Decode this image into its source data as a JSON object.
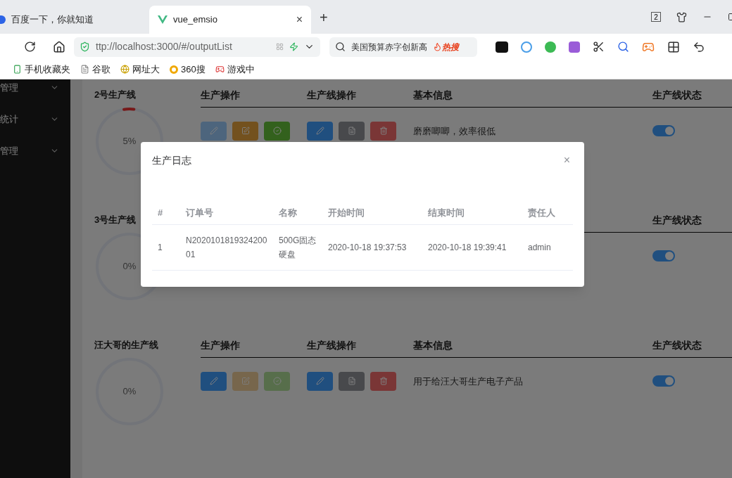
{
  "browser": {
    "tabs": [
      {
        "title": "百度一下，你就知道",
        "selected": false
      },
      {
        "title": "vue_emsio",
        "selected": true,
        "close": "×"
      }
    ],
    "new_tab": "+",
    "window_badge": "2",
    "address": "ttp://localhost:3000/#/outputList",
    "search": {
      "value": "美国预算赤字创新高",
      "hot": "热搜"
    },
    "bookmarks": [
      {
        "label": "手机收藏夹",
        "kind": "phone"
      },
      {
        "label": "谷歌",
        "kind": "page"
      },
      {
        "label": "网址大",
        "kind": "site"
      },
      {
        "label": "360搜",
        "kind": "search"
      },
      {
        "label": "游戏中",
        "kind": "game"
      }
    ]
  },
  "sidebar": {
    "items": [
      {
        "label": "管理"
      },
      {
        "label": "统计"
      },
      {
        "label": "管理"
      }
    ]
  },
  "lines": [
    {
      "name": "2号生产线",
      "percent": "5%",
      "level": 0.05,
      "headers": {
        "ops": "生产操作",
        "line_ops": "生产线操作",
        "info": "基本信息",
        "status": "生产线状态"
      },
      "ops": [
        {
          "kind": "edit",
          "disabled": true
        },
        {
          "kind": "modify",
          "disabled": false
        },
        {
          "kind": "check",
          "disabled": false
        }
      ],
      "line_ops": [
        {
          "kind": "edit"
        },
        {
          "kind": "detail"
        },
        {
          "kind": "delete"
        }
      ],
      "info": "磨磨唧唧，效率很低",
      "on": true
    },
    {
      "name": "3号生产线",
      "percent": "0%",
      "level": 0,
      "headers": {
        "status": "生产线状态"
      },
      "on": true
    },
    {
      "name": "汪大哥的生产线",
      "percent": "0%",
      "level": 0,
      "headers": {
        "ops": "生产操作",
        "line_ops": "生产线操作",
        "info": "基本信息",
        "status": "生产线状态"
      },
      "ops": [
        {
          "kind": "edit",
          "disabled": false
        },
        {
          "kind": "modify",
          "disabled": true
        },
        {
          "kind": "check",
          "disabled": true
        }
      ],
      "line_ops": [
        {
          "kind": "edit"
        },
        {
          "kind": "detail"
        },
        {
          "kind": "delete"
        }
      ],
      "info": "用于给汪大哥生产电子产品",
      "on": true
    }
  ],
  "dialog": {
    "title": "生产日志",
    "close": "×",
    "columns": [
      "#",
      "订单号",
      "名称",
      "开始时间",
      "结束时间",
      "责任人"
    ],
    "rows": [
      {
        "cells": [
          "1",
          "N202010181932420001",
          "500G固态硬盘",
          "2020-10-18 19:37:53",
          "2020-10-18 19:39:41",
          "admin"
        ]
      }
    ]
  }
}
